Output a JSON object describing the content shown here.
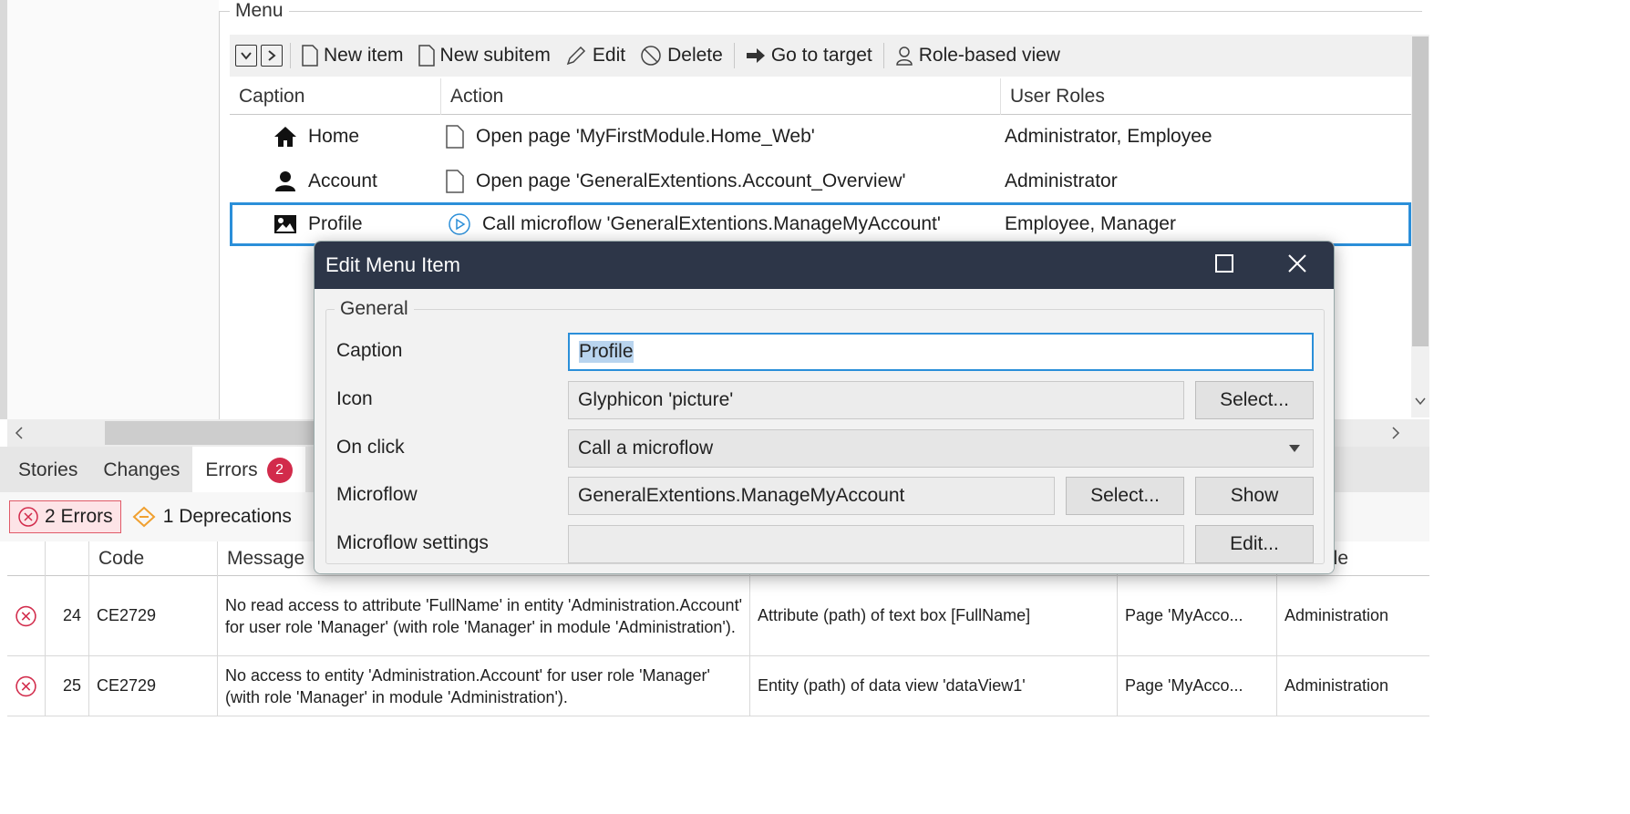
{
  "menu": {
    "legend": "Menu",
    "toolbar": {
      "new_item": "New item",
      "new_subitem": "New subitem",
      "edit": "Edit",
      "delete": "Delete",
      "go_to_target": "Go to target",
      "role_based_view": "Role-based view"
    },
    "columns": {
      "caption": "Caption",
      "action": "Action",
      "user_roles": "User Roles"
    },
    "rows": [
      {
        "icon": "home-icon",
        "caption": "Home",
        "action_icon": "page-icon",
        "action": "Open page 'MyFirstModule.Home_Web'",
        "roles": "Administrator, Employee"
      },
      {
        "icon": "user-icon",
        "caption": "Account",
        "action_icon": "page-icon",
        "action": "Open page 'GeneralExtentions.Account_Overview'",
        "roles": "Administrator"
      },
      {
        "icon": "picture-icon",
        "caption": "Profile",
        "action_icon": "microflow-icon",
        "action": "Call microflow 'GeneralExtentions.ManageMyAccount'",
        "roles": "Employee, Manager"
      }
    ]
  },
  "bottom_panel": {
    "tabs": {
      "stories": "Stories",
      "changes": "Changes",
      "errors": "Errors",
      "errors_badge": "2"
    },
    "filters": {
      "errors": "2 Errors",
      "deprecations": "1 Deprecations"
    },
    "columns": {
      "code": "Code",
      "message": "Message",
      "module_partial": "ule"
    },
    "rows": [
      {
        "number": "24",
        "code": "CE2729",
        "message": "No read access to attribute 'FullName' in entity 'Administration.Account' for user role 'Manager' (with role 'Manager' in module 'Administration').",
        "element": "Attribute (path) of text box [FullName]",
        "document": "Page 'MyAcco...",
        "module": "Administration"
      },
      {
        "number": "25",
        "code": "CE2729",
        "message": "No access to entity 'Administration.Account' for user role 'Manager' (with role 'Manager' in module 'Administration').",
        "element": "Entity (path) of data view 'dataView1'",
        "document": "Page 'MyAcco...",
        "module": "Administration"
      }
    ]
  },
  "dialog": {
    "title": "Edit Menu Item",
    "group": "General",
    "caption_label": "Caption",
    "caption_value": "Profile",
    "icon_label": "Icon",
    "icon_value": "Glyphicon 'picture'",
    "icon_select": "Select...",
    "onclick_label": "On click",
    "onclick_value": "Call a microflow",
    "microflow_label": "Microflow",
    "microflow_value": "GeneralExtentions.ManageMyAccount",
    "microflow_select": "Select...",
    "microflow_show": "Show",
    "settings_label": "Microflow settings",
    "settings_value": "",
    "settings_edit": "Edit..."
  },
  "colors": {
    "accent": "#2b8fd9",
    "title_bar": "#2d3648",
    "error": "#d22b4b"
  }
}
